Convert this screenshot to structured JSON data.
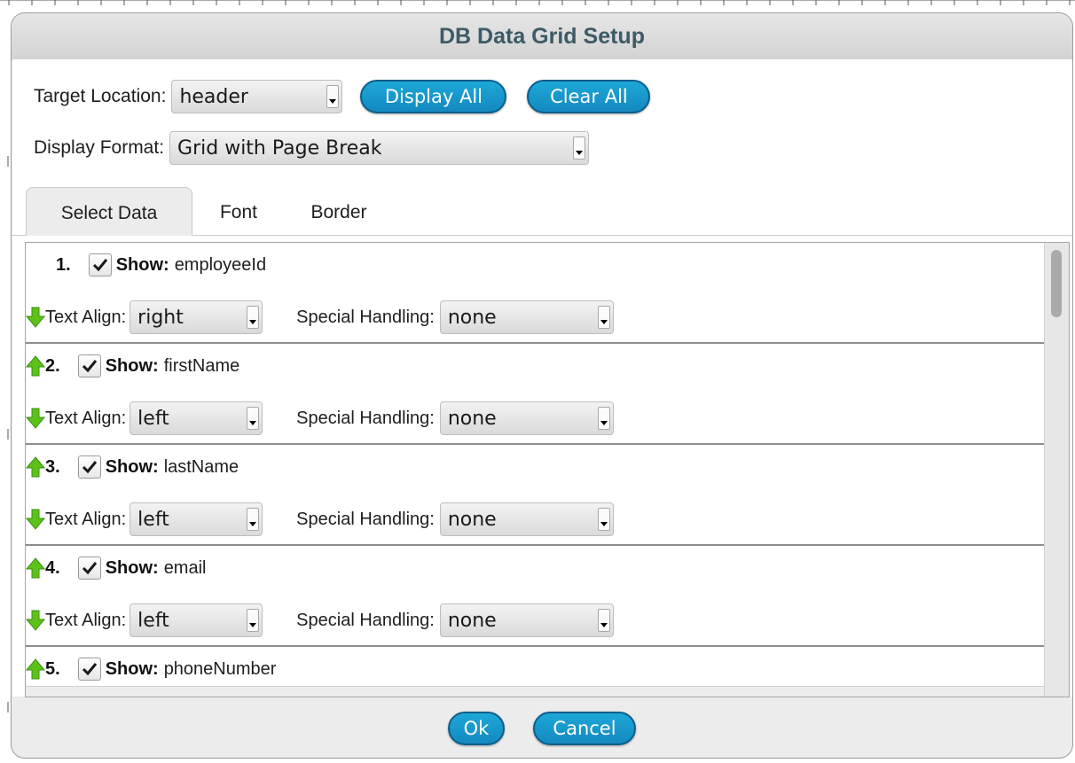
{
  "dialog": {
    "title": "DB Data Grid Setup",
    "target_location_label": "Target Location:",
    "target_location_value": "header",
    "display_all_label": "Display All",
    "clear_all_label": "Clear All",
    "display_format_label": "Display Format:",
    "display_format_value": "Grid with Page Break"
  },
  "tabs": [
    {
      "label": "Select Data",
      "active": true
    },
    {
      "label": "Font",
      "active": false
    },
    {
      "label": "Border",
      "active": false
    }
  ],
  "items": [
    {
      "num": "1.",
      "show_label": "Show:",
      "field": "employeeId",
      "checked": true,
      "text_align_label": "Text Align:",
      "text_align": "right",
      "special_label": "Special Handling:",
      "special": "none"
    },
    {
      "num": "2.",
      "show_label": "Show:",
      "field": "firstName",
      "checked": true,
      "text_align_label": "Text Align:",
      "text_align": "left",
      "special_label": "Special Handling:",
      "special": "none"
    },
    {
      "num": "3.",
      "show_label": "Show:",
      "field": "lastName",
      "checked": true,
      "text_align_label": "Text Align:",
      "text_align": "left",
      "special_label": "Special Handling:",
      "special": "none"
    },
    {
      "num": "4.",
      "show_label": "Show:",
      "field": "email",
      "checked": true,
      "text_align_label": "Text Align:",
      "text_align": "left",
      "special_label": "Special Handling:",
      "special": "none"
    },
    {
      "num": "5.",
      "show_label": "Show:",
      "field": "phoneNumber",
      "checked": true
    }
  ],
  "footer": {
    "ok_label": "Ok",
    "cancel_label": "Cancel"
  },
  "colors": {
    "accent": "#1389bf",
    "arrow_green": "#5cc21a",
    "title_text": "#3d5a66"
  },
  "icons": {
    "move_up": "green-up-arrow-icon",
    "move_down": "green-down-arrow-icon",
    "checkmark": "checkmark-icon"
  }
}
